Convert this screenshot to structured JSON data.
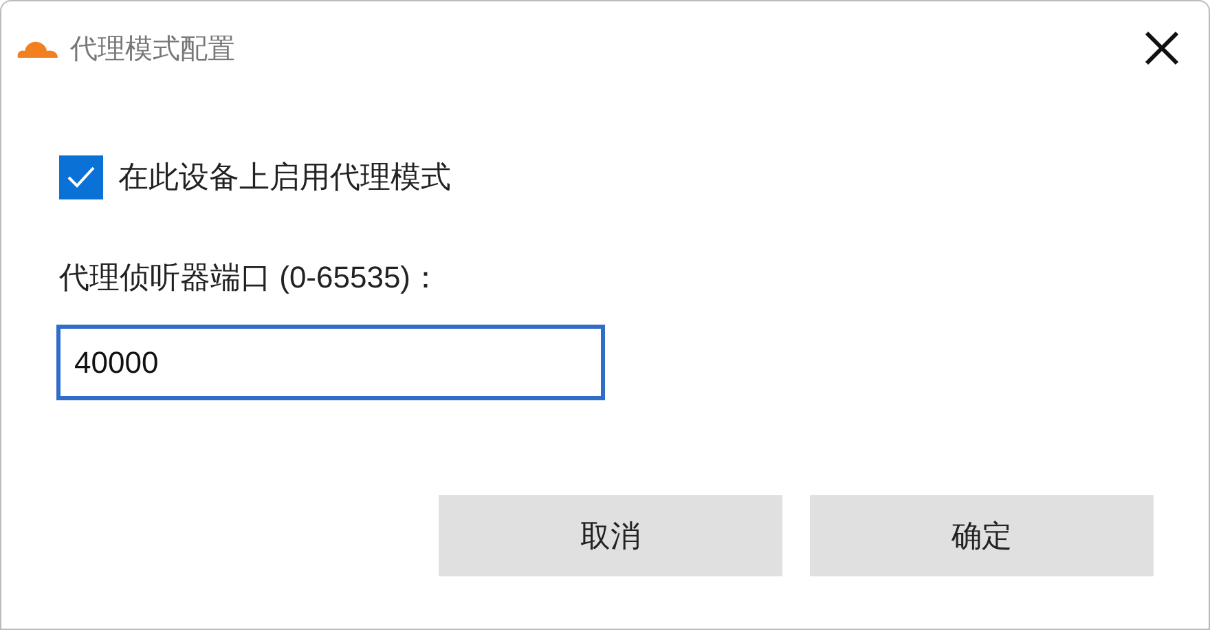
{
  "window": {
    "title": "代理模式配置"
  },
  "enable_proxy": {
    "label": "在此设备上启用代理模式",
    "checked": true
  },
  "port": {
    "label": "代理侦听器端口 (0-65535)：",
    "value": "40000",
    "focused": true
  },
  "buttons": [
    {
      "label": "取消"
    },
    {
      "label": "确定"
    }
  ]
}
